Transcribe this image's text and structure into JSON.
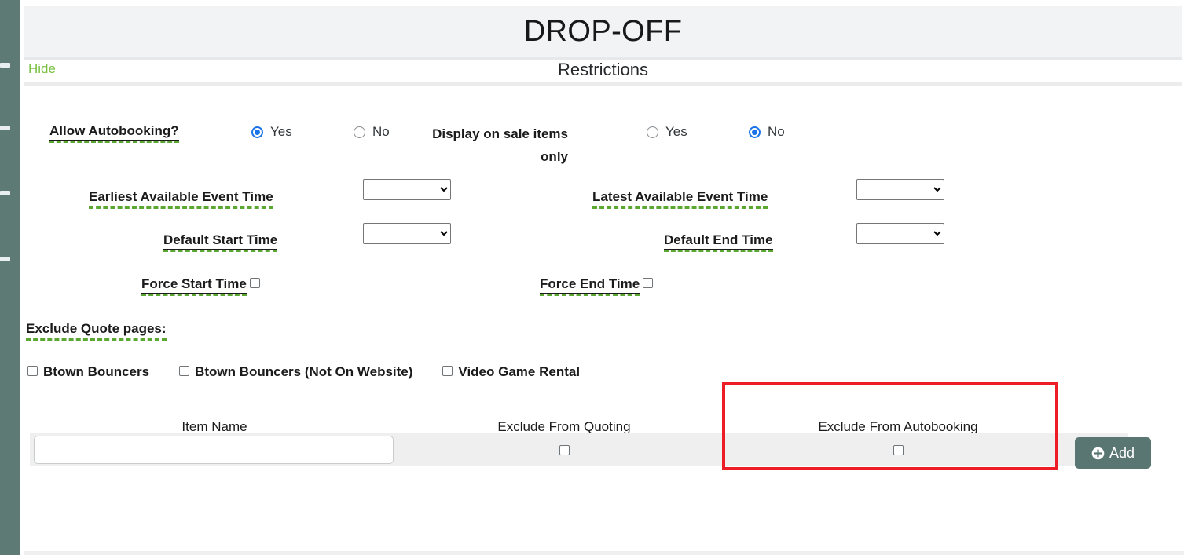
{
  "sidebar": {
    "name": "collapsed-nav-rail",
    "color": "#5d7a75",
    "dash_tops": [
      80,
      160,
      243,
      327
    ]
  },
  "header": {
    "title": "DROP-OFF",
    "section_title": "Restrictions",
    "hide_link": "Hide",
    "hide_color": "#7ac143"
  },
  "form": {
    "allow_autobooking": {
      "label": "Allow Autobooking?",
      "yes_label": "Yes",
      "no_label": "No",
      "selected": "Yes"
    },
    "display_on_sale_items": {
      "label_line1": "Display on sale items",
      "label_line2": "only",
      "yes_label": "Yes",
      "no_label": "No",
      "selected": "No"
    },
    "earliest_available_event_time": {
      "label": "Earliest Available Event Time",
      "value": "",
      "options": [
        ""
      ]
    },
    "latest_available_event_time": {
      "label": "Latest Available Event Time",
      "value": "",
      "options": [
        ""
      ]
    },
    "default_start_time": {
      "label": "Default Start Time",
      "value": "",
      "options": [
        ""
      ]
    },
    "default_end_time": {
      "label": "Default End Time",
      "value": "",
      "options": [
        ""
      ]
    },
    "force_start_time": {
      "label": "Force Start Time",
      "checked": false
    },
    "force_end_time": {
      "label": "Force End Time",
      "checked": false
    },
    "exclude_quote_pages": {
      "label": "Exclude Quote pages:",
      "items": [
        {
          "label": "Btown Bouncers",
          "checked": false
        },
        {
          "label": "Btown Bouncers (Not On Website)",
          "checked": false
        },
        {
          "label": "Video Game Rental",
          "checked": false
        }
      ]
    }
  },
  "table": {
    "columns": [
      "Item Name",
      "Exclude From Quoting",
      "Exclude From Autobooking"
    ],
    "row": {
      "item_name_value": "",
      "exclude_from_quoting": false,
      "exclude_from_autobooking": false
    },
    "add_button": {
      "label": "Add",
      "icon": "plus-circle-icon",
      "color": "#5a7672"
    }
  },
  "annotation": {
    "highlight_color": "#ee1c25",
    "highlights": "Exclude From Autobooking column"
  }
}
